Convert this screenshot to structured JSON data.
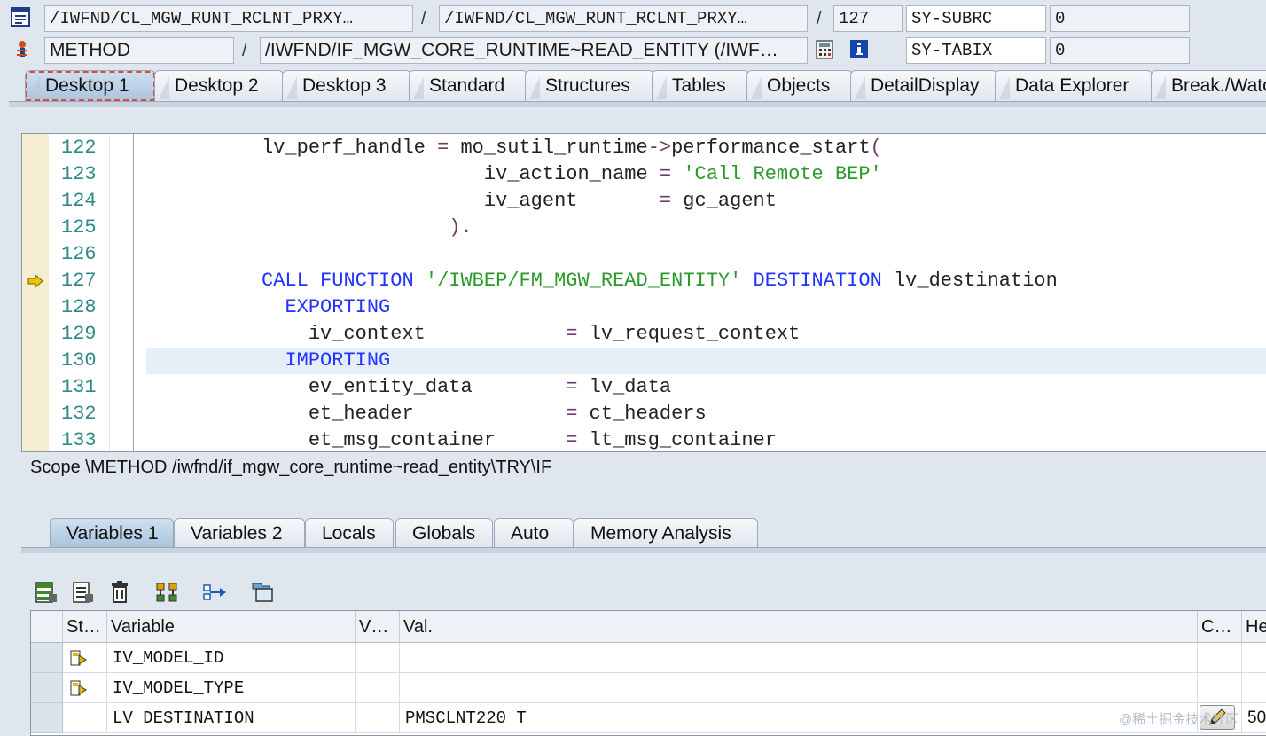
{
  "header": {
    "row1": {
      "program": "/IWFND/CL_MGW_RUNT_RCLNT_PRXY…",
      "include": "/IWFND/CL_MGW_RUNT_RCLNT_PRXY…",
      "line": "127",
      "sys_field1": "SY-SUBRC",
      "sys_value1": "0"
    },
    "row2": {
      "event_type": "METHOD",
      "event": "/IWFND/IF_MGW_CORE_RUNTIME~READ_ENTITY (/IWF…",
      "sys_field2": "SY-TABIX",
      "sys_value2": "0"
    },
    "separator": "/"
  },
  "tabs": [
    "Desktop 1",
    "Desktop 2",
    "Desktop 3",
    "Standard",
    "Structures",
    "Tables",
    "Objects",
    "DetailDisplay",
    "Data Explorer",
    "Break./Watc"
  ],
  "code": {
    "lines": [
      {
        "num": "122",
        "text": "          lv_perf_handle = mo_sutil_runtime->performance_start("
      },
      {
        "num": "123",
        "text": "                             iv_action_name = 'Call Remote BEP'"
      },
      {
        "num": "124",
        "text": "                             iv_agent       = gc_agent"
      },
      {
        "num": "125",
        "text": "                          )."
      },
      {
        "num": "126",
        "text": ""
      },
      {
        "num": "127",
        "text": "          CALL FUNCTION '/IWBEP/FM_MGW_READ_ENTITY' DESTINATION lv_destination"
      },
      {
        "num": "128",
        "text": "            EXPORTING"
      },
      {
        "num": "129",
        "text": "              iv_context            = lv_request_context"
      },
      {
        "num": "130",
        "text": "            IMPORTING"
      },
      {
        "num": "131",
        "text": "              ev_entity_data        = lv_data"
      },
      {
        "num": "132",
        "text": "              et_header             = ct_headers"
      },
      {
        "num": "133",
        "text": "              et_msg_container      = lt_msg_container"
      }
    ],
    "current_line": "127",
    "cursor_line": "130"
  },
  "scope": "Scope \\METHOD /iwfnd/if_mgw_core_runtime~read_entity\\TRY\\IF",
  "var_tabs": [
    "Variables 1",
    "Variables 2",
    "Locals",
    "Globals",
    "Auto",
    "Memory Analysis"
  ],
  "toolbar_icons": [
    "layout-icon",
    "list-icon",
    "trash-icon",
    "hierarchy-icon",
    "transfer-icon",
    "folder-icon"
  ],
  "grid": {
    "headers": {
      "status": "St…",
      "variable": "Variable",
      "v": "V…",
      "value": "Val.",
      "c": "C…",
      "he": "He"
    },
    "rows": [
      {
        "variable": "IV_MODEL_ID",
        "value": "",
        "has_icon": true,
        "he": ""
      },
      {
        "variable": "IV_MODEL_TYPE",
        "value": "",
        "has_icon": true,
        "he": ""
      },
      {
        "variable": "LV_DESTINATION",
        "value": "PMSCLNT220_T",
        "has_icon": false,
        "he": "50"
      }
    ]
  },
  "watermark": "@稀土掘金技术社区",
  "colors": {
    "keyword": "#2233ff",
    "string": "#2a9a2a",
    "linenumber": "#2d8a86",
    "tab_active": "#a9c3dc"
  }
}
